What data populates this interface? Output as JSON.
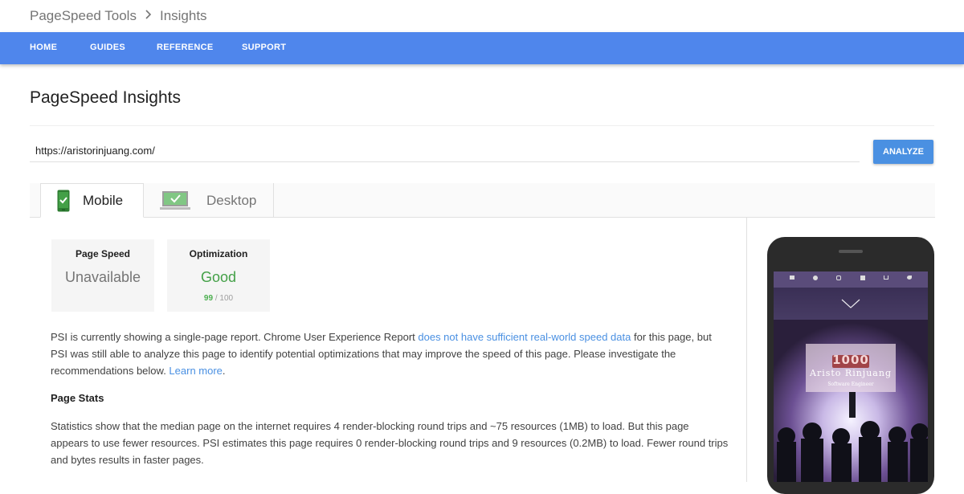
{
  "breadcrumb": {
    "root": "PageSpeed Tools",
    "current": "Insights"
  },
  "nav": {
    "items": [
      "HOME",
      "GUIDES",
      "REFERENCE",
      "SUPPORT"
    ]
  },
  "page": {
    "title": "PageSpeed Insights"
  },
  "url_input": {
    "value": "https://aristorinjuang.com/"
  },
  "analyze": {
    "label": "ANALYZE"
  },
  "tabs": {
    "mobile": "Mobile",
    "desktop": "Desktop"
  },
  "cards": {
    "page_speed": {
      "title": "Page Speed",
      "value": "Unavailable"
    },
    "optimization": {
      "title": "Optimization",
      "value": "Good",
      "score": "99",
      "max": "/ 100"
    }
  },
  "report": {
    "p1_a": "PSI is currently showing a single-page report. Chrome User Experience Report ",
    "p1_link": "does not have sufficient real-world speed data",
    "p1_b": " for this page, but PSI was still able to analyze this page to identify potential optimizations that may improve the speed of this page. Please investigate the recommendations below. ",
    "p1_learn": "Learn more",
    "p1_end": "."
  },
  "stats": {
    "heading": "Page Stats",
    "text": "Statistics show that the median page on the internet requires 4 render-blocking round trips and ~75 resources (1MB) to load. But this page appears to use fewer resources. PSI estimates this page requires 0 render-blocking round trips and 9 resources (0.2MB) to load. Fewer round trips and bytes results in faster pages."
  },
  "preview": {
    "badge": "1000",
    "name": "Aristo Rinjuang",
    "subtitle": "Software Engineer"
  },
  "colors": {
    "nav_bg": "#4f86ec",
    "accent": "#4a90e2",
    "good": "#43a047"
  }
}
